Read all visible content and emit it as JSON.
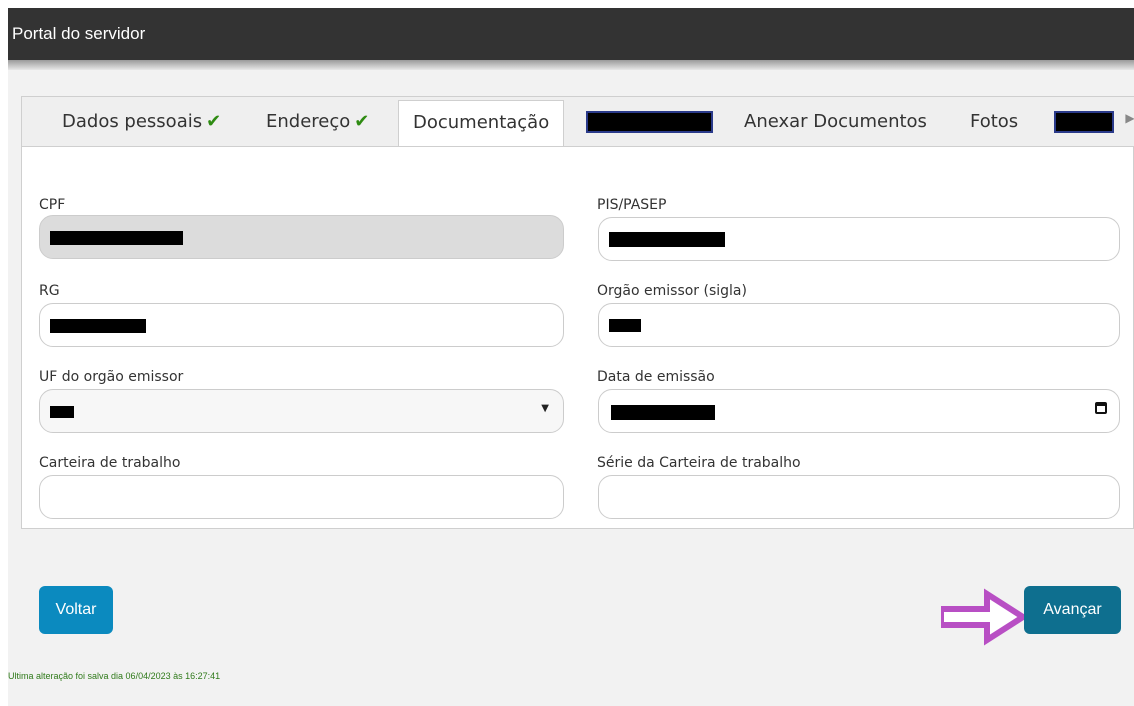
{
  "header": {
    "title": "Portal do servidor"
  },
  "tabs": [
    {
      "label": "Dados pessoais",
      "complete": true,
      "check": "✔"
    },
    {
      "label": "Endereço",
      "complete": true,
      "check": "✔"
    },
    {
      "label": "Documentação",
      "active": true
    },
    {
      "label": "",
      "redacted": true
    },
    {
      "label": "Anexar Documentos"
    },
    {
      "label": "Fotos"
    },
    {
      "label": "",
      "redacted": true
    }
  ],
  "form": {
    "cpf": {
      "label": "CPF",
      "value": "",
      "redacted": true,
      "disabled": true
    },
    "pis": {
      "label": "PIS/PASEP",
      "value": "",
      "redacted": true
    },
    "rg": {
      "label": "RG",
      "value": "",
      "redacted": true
    },
    "orgao": {
      "label": "Orgão emissor (sigla)",
      "value": "",
      "redacted": true
    },
    "uf": {
      "label": "UF do orgão emissor",
      "value": "",
      "redacted": true
    },
    "data_emissao": {
      "label": "Data de emissão",
      "value": "",
      "redacted": true
    },
    "carteira": {
      "label": "Carteira de trabalho",
      "value": ""
    },
    "serie": {
      "label": "Série da Carteira de trabalho",
      "value": ""
    }
  },
  "buttons": {
    "back": "Voltar",
    "next": "Avançar"
  },
  "annotation": {
    "arrow_color": "#b84fc4"
  },
  "status": "Ultima alteração foi salva dia 06/04/2023 às 16:27:41",
  "colors": {
    "header": "#333333",
    "button": "#0b8abf",
    "button_next": "#0e6f8f",
    "check": "#2e8b12"
  }
}
